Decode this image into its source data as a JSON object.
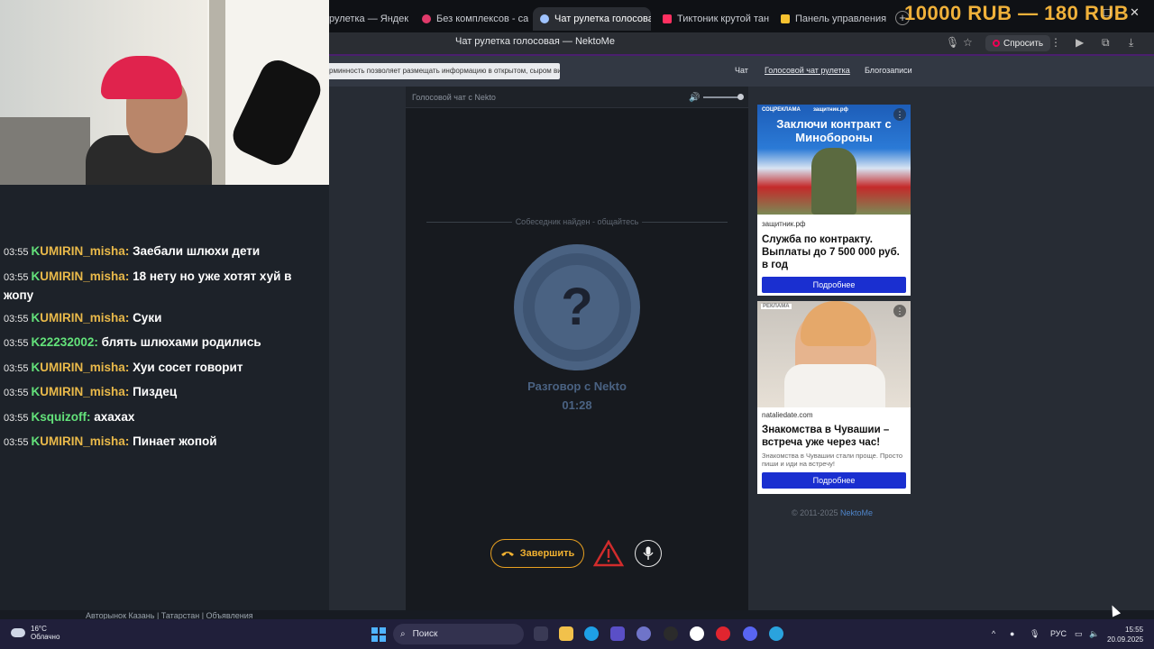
{
  "browser": {
    "tabs": [
      {
        "label": "рулетка — Яндекс: на",
        "color": "#f2f2f2"
      },
      {
        "label": "Без комплексов - сайт зн",
        "color": "#e03a6a"
      },
      {
        "label": "Чат рулетка голосовая",
        "color": "#9fc3ff"
      },
      {
        "label": "Тиктоник крутой танец",
        "color": "#ff3060"
      },
      {
        "label": "Панель управления - Don",
        "color": "#f7c230"
      }
    ],
    "page_title": "Чат рулетка голосовая — NektoMe",
    "ask_label": "Спросить",
    "stream_overlay": "10000 RUB — 180 RUB"
  },
  "site": {
    "notice": "рминность позволяет размещать информацию в открытом, сыром виде!",
    "nav": [
      "Чат",
      "Голосовой чат рулетка",
      "Блогозаписи"
    ],
    "chat_header": "Голосовой чат с Nekto",
    "status": "Собеседник найден - общайтесь",
    "avatar_symbol": "?",
    "conversation_label": "Разговор с Nekto",
    "timer": "01:28",
    "end_button": "Завершить",
    "copyright": "© 2011-2025",
    "copyright_brand": "NektoMe"
  },
  "ads": [
    {
      "label": "СОЦРЕКЛАМА",
      "image_headline": "Заключи контракт с Минобороны",
      "image_brand": "защитник.рф",
      "domain": "защитник.рф",
      "title": "Служба по контракту. Выплаты до 7 500 000 руб. в год",
      "text": "",
      "button": "Подробнее"
    },
    {
      "label": "РЕКЛАМА",
      "domain": "nataliedate.com",
      "title": "Знакомства в Чувашии – встреча уже через час!",
      "text": "Знакомства в Чувашии стали проще. Просто пиши и иди на встречу!",
      "button": "Подробнее"
    }
  ],
  "chat": [
    {
      "time": "03:55",
      "user": "UMIRIN_misha",
      "user_color": "#e9b94a",
      "text": "Заебали шлюхи дети"
    },
    {
      "time": "03:55",
      "user": "UMIRIN_misha",
      "user_color": "#e9b94a",
      "text": "18 нету но уже хотят хуй в жопу"
    },
    {
      "time": "03:55",
      "user": "UMIRIN_misha",
      "user_color": "#e9b94a",
      "text": "Суки"
    },
    {
      "time": "03:55",
      "user": "22232002",
      "user_color": "#63e27a",
      "text": "блять шлюхами родились"
    },
    {
      "time": "03:55",
      "user": "UMIRIN_misha",
      "user_color": "#e9b94a",
      "text": "Хуи сосет говорит"
    },
    {
      "time": "03:55",
      "user": "UMIRIN_misha",
      "user_color": "#e9b94a",
      "text": "Пиздец"
    },
    {
      "time": "03:55",
      "user": "squizoff",
      "user_color": "#63e27a",
      "text": "ахахах"
    },
    {
      "time": "03:55",
      "user": "UMIRIN_misha",
      "user_color": "#e9b94a",
      "text": "Пинает жопой"
    }
  ],
  "background_strip": "Авторынок Казань | Татарстан | Объявления",
  "taskbar": {
    "temperature": "16°C",
    "weather": "Облачно",
    "search": "Поиск",
    "language": "РУС",
    "time": "15:55",
    "date": "20.09.2025"
  }
}
